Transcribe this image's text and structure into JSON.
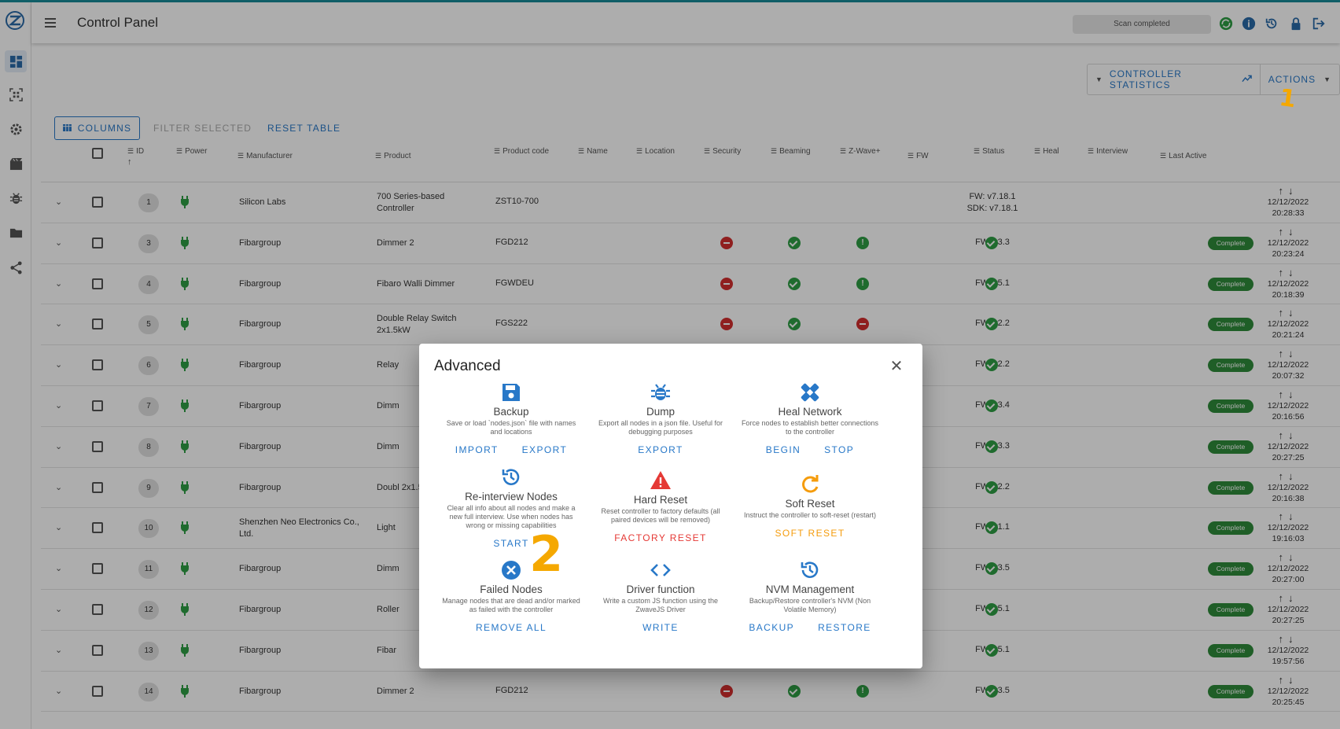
{
  "app": {
    "title": "Control Panel",
    "status": "Scan completed",
    "colors": {
      "accent": "#2878c8",
      "success": "#2e9e44",
      "danger": "#d32f2f",
      "warning": "#f59c0c",
      "annotation": "#f5a800"
    }
  },
  "sidebar": {
    "items": [
      {
        "name": "dashboard-icon"
      },
      {
        "name": "qr-scan-icon"
      },
      {
        "name": "settings-icon"
      },
      {
        "name": "scenes-icon"
      },
      {
        "name": "debug-bug-icon"
      },
      {
        "name": "folder-icon"
      },
      {
        "name": "share-icon"
      }
    ]
  },
  "toolbar": {
    "controller_statistics": "CONTROLLER STATISTICS",
    "actions": "ACTIONS",
    "columns": "COLUMNS",
    "filter_selected": "FILTER SELECTED",
    "reset_table": "RESET TABLE"
  },
  "table": {
    "headers": {
      "id": "ID",
      "power": "Power",
      "manufacturer": "Manufacturer",
      "product": "Product",
      "product_code": "Product code",
      "name": "Name",
      "location": "Location",
      "security": "Security",
      "beaming": "Beaming",
      "zwave_plus": "Z-Wave+",
      "fw": "FW",
      "status": "Status",
      "heal": "Heal",
      "interview": "Interview",
      "last_active": "Last Active"
    },
    "rows": [
      {
        "id": "1",
        "manufacturer": "Silicon Labs",
        "product": "700 Series-based Controller",
        "code": "ZST10-700",
        "security": "",
        "beaming": "",
        "zwave": "",
        "fw": "FW: v7.18.1",
        "fw2": "SDK: v7.18.1",
        "status": "",
        "interview": "",
        "date": "12/12/2022",
        "time": "20:28:33"
      },
      {
        "id": "3",
        "manufacturer": "Fibargroup",
        "product": "Dimmer 2",
        "code": "FGD212",
        "security": "red",
        "beaming": "green",
        "zwave": "info",
        "fw": "FW: v3.3",
        "fw2": "",
        "status": "green",
        "interview": "Complete",
        "date": "12/12/2022",
        "time": "20:23:24"
      },
      {
        "id": "4",
        "manufacturer": "Fibargroup",
        "product": "Fibaro Walli Dimmer",
        "code": "FGWDEU",
        "security": "red",
        "beaming": "green",
        "zwave": "info",
        "fw": "FW: v5.1",
        "fw2": "",
        "status": "green",
        "interview": "Complete",
        "date": "12/12/2022",
        "time": "20:18:39"
      },
      {
        "id": "5",
        "manufacturer": "Fibargroup",
        "product": "Double Relay Switch 2x1.5kW",
        "code": "FGS222",
        "security": "red",
        "beaming": "green",
        "zwave": "red",
        "fw": "FW: v2.2",
        "fw2": "",
        "status": "green",
        "interview": "Complete",
        "date": "12/12/2022",
        "time": "20:21:24"
      },
      {
        "id": "6",
        "manufacturer": "Fibargroup",
        "product": "Relay",
        "code": "",
        "security": "",
        "beaming": "",
        "zwave": "red",
        "fw": "FW: v2.2",
        "fw2": "",
        "status": "green",
        "interview": "Complete",
        "date": "12/12/2022",
        "time": "20:07:32"
      },
      {
        "id": "7",
        "manufacturer": "Fibargroup",
        "product": "Dimm",
        "code": "",
        "security": "",
        "beaming": "",
        "zwave": "info",
        "fw": "FW: v3.4",
        "fw2": "",
        "status": "green",
        "interview": "Complete",
        "date": "12/12/2022",
        "time": "20:16:56"
      },
      {
        "id": "8",
        "manufacturer": "Fibargroup",
        "product": "Dimm",
        "code": "",
        "security": "",
        "beaming": "",
        "zwave": "info",
        "fw": "FW: v3.3",
        "fw2": "",
        "status": "green",
        "interview": "Complete",
        "date": "12/12/2022",
        "time": "20:27:25"
      },
      {
        "id": "9",
        "manufacturer": "Fibargroup",
        "product": "Doubl 2x1.5",
        "code": "",
        "security": "",
        "beaming": "",
        "zwave": "red",
        "fw": "FW: v2.2",
        "fw2": "",
        "status": "green",
        "interview": "Complete",
        "date": "12/12/2022",
        "time": "20:16:38"
      },
      {
        "id": "10",
        "manufacturer": "Shenzhen Neo Electronics Co., Ltd.",
        "product": "Light",
        "code": "",
        "security": "",
        "beaming": "",
        "zwave": "info",
        "fw": "FW: v1.1",
        "fw2": "",
        "status": "green",
        "interview": "Complete",
        "date": "12/12/2022",
        "time": "19:16:03"
      },
      {
        "id": "11",
        "manufacturer": "Fibargroup",
        "product": "Dimm",
        "code": "",
        "security": "",
        "beaming": "",
        "zwave": "info",
        "fw": "FW: v3.5",
        "fw2": "",
        "status": "green",
        "interview": "Complete",
        "date": "12/12/2022",
        "time": "20:27:00"
      },
      {
        "id": "12",
        "manufacturer": "Fibargroup",
        "product": "Roller",
        "code": "",
        "security": "",
        "beaming": "",
        "zwave": "info",
        "fw": "FW: v5.1",
        "fw2": "",
        "status": "green",
        "interview": "Complete",
        "date": "12/12/2022",
        "time": "20:27:25"
      },
      {
        "id": "13",
        "manufacturer": "Fibargroup",
        "product": "Fibar",
        "code": "",
        "security": "",
        "beaming": "",
        "zwave": "info",
        "fw": "FW: v5.1",
        "fw2": "",
        "status": "green",
        "interview": "Complete",
        "date": "12/12/2022",
        "time": "19:57:56"
      },
      {
        "id": "14",
        "manufacturer": "Fibargroup",
        "product": "Dimmer 2",
        "code": "FGD212",
        "security": "red",
        "beaming": "green",
        "zwave": "info",
        "fw": "FW: v3.5",
        "fw2": "",
        "status": "green",
        "interview": "Complete",
        "date": "12/12/2022",
        "time": "20:25:45"
      }
    ]
  },
  "dialog": {
    "title": "Advanced",
    "actions": [
      {
        "key": "backup",
        "icon": "save-icon",
        "title": "Backup",
        "desc": "Save or load `nodes.json` file with names and locations",
        "buttons": [
          {
            "label": "IMPORT",
            "style": ""
          },
          {
            "label": "EXPORT",
            "style": ""
          }
        ]
      },
      {
        "key": "dump",
        "icon": "bug-icon",
        "title": "Dump",
        "desc": "Export all nodes in a json file. Useful for debugging purposes",
        "buttons": [
          {
            "label": "EXPORT",
            "style": ""
          }
        ]
      },
      {
        "key": "heal",
        "icon": "bandage-icon",
        "title": "Heal Network",
        "desc": "Force nodes to establish better connections to the controller",
        "buttons": [
          {
            "label": "BEGIN",
            "style": ""
          },
          {
            "label": "STOP",
            "style": ""
          }
        ]
      },
      {
        "key": "reinterview",
        "icon": "history-icon",
        "title": "Re-interview Nodes",
        "desc": "Clear all info about all nodes and make a new full interview. Use when nodes has wrong or missing capabilities",
        "buttons": [
          {
            "label": "START",
            "style": ""
          }
        ]
      },
      {
        "key": "hardreset",
        "icon": "warning-icon",
        "title": "Hard Reset",
        "desc": "Reset controller to factory defaults (all paired devices will be removed)",
        "buttons": [
          {
            "label": "FACTORY RESET",
            "style": "red"
          }
        ]
      },
      {
        "key": "softreset",
        "icon": "refresh-icon",
        "title": "Soft Reset",
        "desc": "Instruct the controller to soft-reset (restart)",
        "buttons": [
          {
            "label": "SOFT RESET",
            "style": "orange"
          }
        ]
      },
      {
        "key": "failed",
        "icon": "close-circle-icon",
        "title": "Failed Nodes",
        "desc": "Manage nodes that are dead and/or marked as failed with the controller",
        "buttons": [
          {
            "label": "REMOVE ALL",
            "style": ""
          }
        ]
      },
      {
        "key": "driver",
        "icon": "code-icon",
        "title": "Driver function",
        "desc": "Write a custom JS function using the ZwaveJS Driver",
        "buttons": [
          {
            "label": "WRITE",
            "style": ""
          }
        ]
      },
      {
        "key": "nvm",
        "icon": "restore-clock-icon",
        "title": "NVM Management",
        "desc": "Backup/Restore controller's NVM (Non Volatile Memory)",
        "buttons": [
          {
            "label": "BACKUP",
            "style": ""
          },
          {
            "label": "RESTORE",
            "style": ""
          }
        ]
      }
    ]
  },
  "annotations": {
    "one": "1",
    "two": "2"
  }
}
